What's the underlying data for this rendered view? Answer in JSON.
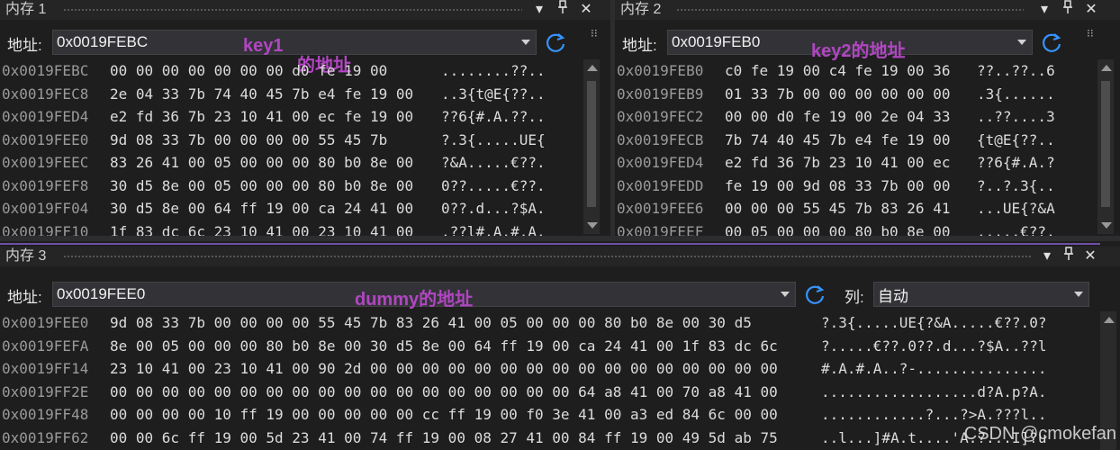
{
  "pane1": {
    "title": "内存 1",
    "address_label": "地址:",
    "address_value": "0x0019FEBC",
    "annotations": [
      "key1",
      "的地址"
    ],
    "rows": [
      {
        "addr": "0x0019FEBC",
        "hex": "00 00 00 00 00 00 00 d0 fe 19 00",
        "ascii": "........??.."
      },
      {
        "addr": "0x0019FEC8",
        "hex": "2e 04 33 7b 74 40 45 7b e4 fe 19 00",
        "ascii": "..3{t@E{??.."
      },
      {
        "addr": "0x0019FED4",
        "hex": "e2 fd 36 7b 23 10 41 00 ec fe 19 00",
        "ascii": "??6{#.A.??.."
      },
      {
        "addr": "0x0019FEE0",
        "hex": "9d 08 33 7b 00 00 00 00 55 45 7b",
        "ascii": "?.3{.....UE{"
      },
      {
        "addr": "0x0019FEEC",
        "hex": "83 26 41 00 05 00 00 00 80 b0 8e 00",
        "ascii": "?&A.....€??."
      },
      {
        "addr": "0x0019FEF8",
        "hex": "30 d5 8e 00 05 00 00 00 80 b0 8e 00",
        "ascii": "0??.....€??."
      },
      {
        "addr": "0x0019FF04",
        "hex": "30 d5 8e 00 64 ff 19 00 ca 24 41 00",
        "ascii": "0??.d...?$A."
      },
      {
        "addr": "0x0019FF10",
        "hex": "1f 83 dc 6c 23 10 41 00 23 10 41 00",
        "ascii": ".??l#.A.#.A."
      }
    ]
  },
  "pane2": {
    "title": "内存 2",
    "address_label": "地址:",
    "address_value": "0x0019FEB0",
    "annotation": "key2的地址",
    "rows": [
      {
        "addr": "0x0019FEB0",
        "hex": "c0 fe 19 00 c4 fe 19 00 36",
        "ascii": "??..??..6"
      },
      {
        "addr": "0x0019FEB9",
        "hex": "01 33 7b 00 00 00 00 00 00",
        "ascii": ".3{......"
      },
      {
        "addr": "0x0019FEC2",
        "hex": "00 00 d0 fe 19 00 2e 04 33",
        "ascii": "..??....3"
      },
      {
        "addr": "0x0019FECB",
        "hex": "7b 74 40 45 7b e4 fe 19 00",
        "ascii": "{t@E{??.."
      },
      {
        "addr": "0x0019FED4",
        "hex": "e2 fd 36 7b 23 10 41 00 ec",
        "ascii": "??6{#.A.?"
      },
      {
        "addr": "0x0019FEDD",
        "hex": "fe 19 00 9d 08 33 7b 00 00",
        "ascii": "?..?.3{.."
      },
      {
        "addr": "0x0019FEE6",
        "hex": "00 00 00 55 45 7b 83 26 41",
        "ascii": "...UE{?&A"
      },
      {
        "addr": "0x0019FEEF",
        "hex": "00 05 00 00 00 80 b0 8e 00",
        "ascii": ".....€??."
      }
    ]
  },
  "pane3": {
    "title": "内存 3",
    "address_label": "地址:",
    "address_value": "0x0019FEE0",
    "annotation": "dummy的地址",
    "columns_label": "列:",
    "columns_value": "自动",
    "rows": [
      {
        "addr": "0x0019FEE0",
        "hex": "9d 08 33 7b 00 00 00 00 55 45 7b 83 26 41 00 05 00 00 00 80 b0 8e 00 30 d5",
        "ascii": "?.3{.....UE{?&A.....€??.0?"
      },
      {
        "addr": "0x0019FEFA",
        "hex": "8e 00 05 00 00 00 80 b0 8e 00 30 d5 8e 00 64 ff 19 00 ca 24 41 00 1f 83 dc 6c",
        "ascii": "?.....€??.0??.d...?$A..??l"
      },
      {
        "addr": "0x0019FF14",
        "hex": "23 10 41 00 23 10 41 00 90 2d 00 00 00 00 00 00 00 00 00 00 00 00 00 00 00 00",
        "ascii": "#.A.#.A..?-..............."
      },
      {
        "addr": "0x0019FF2E",
        "hex": "00 00 00 00 00 00 00 00 00 00 00 00 00 00 00 00 00 00 64 a8 41 00 70 a8 41 00",
        "ascii": "..................d?A.p?A."
      },
      {
        "addr": "0x0019FF48",
        "hex": "00 00 00 00 10 ff 19 00 00 00 00 00 cc ff 19 00 f0 3e 41 00 a3 ed 84 6c 00 00",
        "ascii": "............?...?>A.???l.."
      },
      {
        "addr": "0x0019FF62",
        "hex": "00 00 6c ff 19 00 5d 23 41 00 74 ff 19 00 08 27 41 00 84 ff 19 00 49 5d ab 75",
        "ascii": "..l...]#A.t....'A.?...I]?u"
      }
    ]
  },
  "watermark": "CSDN @cmokefan",
  "icons": {
    "dropdown": "chevron-down-icon",
    "pin": "pin-icon",
    "close": "close-icon",
    "refresh": "refresh-icon",
    "overflow": "overflow-icon"
  }
}
